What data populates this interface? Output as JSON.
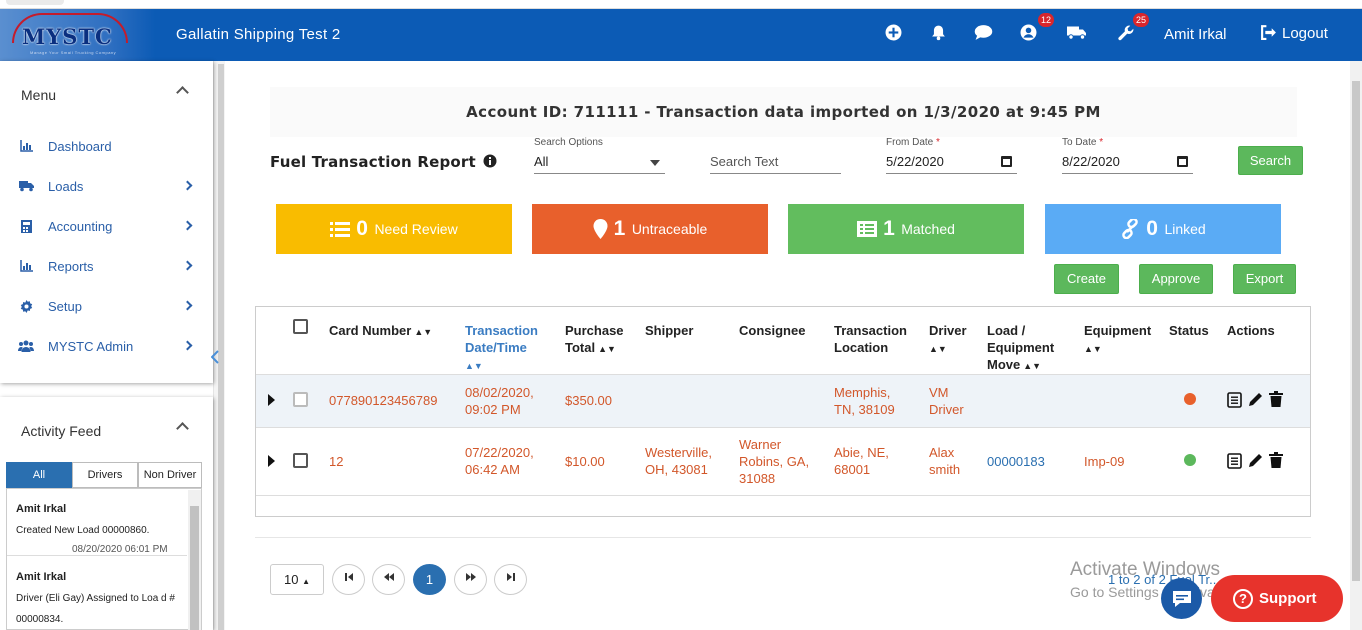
{
  "header": {
    "logo_text": "MYSTC",
    "logo_subtext": "Manage Your Small Trucking Company",
    "app_title": "Gallatin Shipping Test 2",
    "notifications_badge": "12",
    "tools_badge": "25",
    "user_name": "Amit Irkal",
    "logout_label": "Logout",
    "icons": [
      "plus-circle-icon",
      "bell-icon",
      "comment-icon",
      "user-circle-icon",
      "truck-icon",
      "wrench-icon",
      "sign-out-icon"
    ]
  },
  "sidebar": {
    "menu_title": "Menu",
    "items": [
      {
        "label": "Dashboard",
        "icon": "bar-chart-icon",
        "has_submenu": false
      },
      {
        "label": "Loads",
        "icon": "truck-icon",
        "has_submenu": true
      },
      {
        "label": "Accounting",
        "icon": "calculator-icon",
        "has_submenu": true
      },
      {
        "label": "Reports",
        "icon": "bar-chart-icon",
        "has_submenu": true
      },
      {
        "label": "Setup",
        "icon": "gear-icon",
        "has_submenu": true
      },
      {
        "label": "MYSTC Admin",
        "icon": "users-icon",
        "has_submenu": true
      }
    ]
  },
  "activity_feed": {
    "title": "Activity Feed",
    "tabs": [
      "All",
      "Drivers",
      "Non Driver"
    ],
    "active_tab": "All",
    "entries": [
      {
        "name": "Amit Irkal",
        "text": "Created New Load 00000860.",
        "time": "08/20/2020 06:01 PM"
      },
      {
        "name": "Amit Irkal",
        "text": "Driver (Eli Gay) Assigned to Loa d # 00000834.",
        "time": ""
      }
    ]
  },
  "main": {
    "account_banner": "Account ID: 711111 - Transaction data imported on 1/3/2020 at 9:45 PM",
    "report_title": "Fuel Transaction Report",
    "filters": {
      "search_options_label": "Search Options",
      "search_options_value": "All",
      "search_text_placeholder": "Search Text",
      "from_date_label": "From Date",
      "from_date_value": "5/22/2020",
      "to_date_label": "To Date",
      "to_date_value": "8/22/2020",
      "required_mark": "*",
      "search_button": "Search"
    },
    "status_boxes": [
      {
        "count": "0",
        "label": "Need Review",
        "color": "#f9bc00",
        "icon": "list-icon"
      },
      {
        "count": "1",
        "label": "Untraceable",
        "color": "#e8602c",
        "icon": "map-marker-icon"
      },
      {
        "count": "1",
        "label": "Matched",
        "color": "#62bd5e",
        "icon": "list-alt-icon"
      },
      {
        "count": "0",
        "label": "Linked",
        "color": "#5aabf5",
        "icon": "link-icon"
      }
    ],
    "actions": {
      "create": "Create",
      "approve": "Approve",
      "export": "Export"
    },
    "table": {
      "headers": {
        "card_number": "Card Number",
        "transaction_date": "Transaction Date/Time",
        "purchase_total": "Purchase Total",
        "shipper": "Shipper",
        "consignee": "Consignee",
        "transaction_location": "Transaction Location",
        "driver": "Driver",
        "load_move": "Load / Equipment Move",
        "equipment": "Equipment",
        "status": "Status",
        "actions": "Actions"
      },
      "rows": [
        {
          "card": "077890123456789",
          "date1": "08/02/2020,",
          "date2": "09:02 PM",
          "total": "$350.00",
          "shipper1": "",
          "shipper2": "",
          "consignee1": "",
          "consignee2": "",
          "consignee3": "",
          "loc1": "Memphis,",
          "loc2": "TN, 38109",
          "driver1": "VM",
          "driver2": "Driver",
          "load": "",
          "equipment": "",
          "status_color": "#e8602c"
        },
        {
          "card": "12",
          "date1": "07/22/2020,",
          "date2": "06:42 AM",
          "total": "$10.00",
          "shipper1": "Westerville,",
          "shipper2": "OH, 43081",
          "consignee1": "Warner",
          "consignee2": "Robins, GA,",
          "consignee3": "31088",
          "loc1": "Abie, NE,",
          "loc2": "68001",
          "driver1": "Alax",
          "driver2": "smith",
          "load": "00000183",
          "equipment": "Imp-09",
          "status_color": "#5cb85c"
        }
      ]
    },
    "pager": {
      "page_size": "10",
      "current_page": "1",
      "info": "1 to 2 of 2 Fuel Tr..."
    }
  },
  "overlay": {
    "watermark_line1": "Activate Windows",
    "watermark_line2": "Go to Settings to activate Windows.",
    "support_label": "Support"
  }
}
